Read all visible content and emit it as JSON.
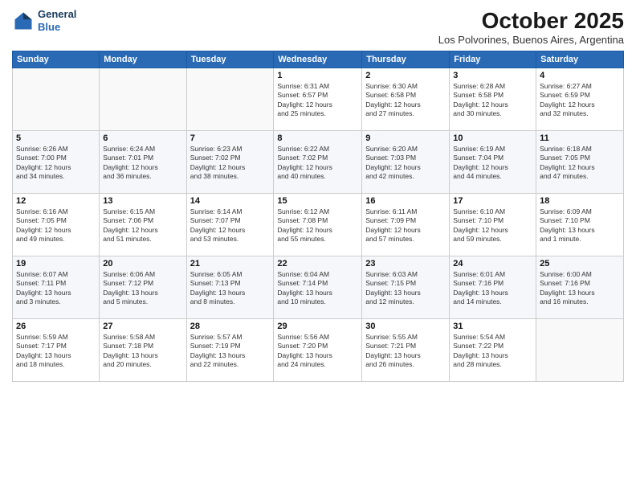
{
  "header": {
    "logo_line1": "General",
    "logo_line2": "Blue",
    "month": "October 2025",
    "location": "Los Polvorines, Buenos Aires, Argentina"
  },
  "weekdays": [
    "Sunday",
    "Monday",
    "Tuesday",
    "Wednesday",
    "Thursday",
    "Friday",
    "Saturday"
  ],
  "rows": [
    [
      {
        "day": "",
        "text": ""
      },
      {
        "day": "",
        "text": ""
      },
      {
        "day": "",
        "text": ""
      },
      {
        "day": "1",
        "text": "Sunrise: 6:31 AM\nSunset: 6:57 PM\nDaylight: 12 hours\nand 25 minutes."
      },
      {
        "day": "2",
        "text": "Sunrise: 6:30 AM\nSunset: 6:58 PM\nDaylight: 12 hours\nand 27 minutes."
      },
      {
        "day": "3",
        "text": "Sunrise: 6:28 AM\nSunset: 6:58 PM\nDaylight: 12 hours\nand 30 minutes."
      },
      {
        "day": "4",
        "text": "Sunrise: 6:27 AM\nSunset: 6:59 PM\nDaylight: 12 hours\nand 32 minutes."
      }
    ],
    [
      {
        "day": "5",
        "text": "Sunrise: 6:26 AM\nSunset: 7:00 PM\nDaylight: 12 hours\nand 34 minutes."
      },
      {
        "day": "6",
        "text": "Sunrise: 6:24 AM\nSunset: 7:01 PM\nDaylight: 12 hours\nand 36 minutes."
      },
      {
        "day": "7",
        "text": "Sunrise: 6:23 AM\nSunset: 7:02 PM\nDaylight: 12 hours\nand 38 minutes."
      },
      {
        "day": "8",
        "text": "Sunrise: 6:22 AM\nSunset: 7:02 PM\nDaylight: 12 hours\nand 40 minutes."
      },
      {
        "day": "9",
        "text": "Sunrise: 6:20 AM\nSunset: 7:03 PM\nDaylight: 12 hours\nand 42 minutes."
      },
      {
        "day": "10",
        "text": "Sunrise: 6:19 AM\nSunset: 7:04 PM\nDaylight: 12 hours\nand 44 minutes."
      },
      {
        "day": "11",
        "text": "Sunrise: 6:18 AM\nSunset: 7:05 PM\nDaylight: 12 hours\nand 47 minutes."
      }
    ],
    [
      {
        "day": "12",
        "text": "Sunrise: 6:16 AM\nSunset: 7:05 PM\nDaylight: 12 hours\nand 49 minutes."
      },
      {
        "day": "13",
        "text": "Sunrise: 6:15 AM\nSunset: 7:06 PM\nDaylight: 12 hours\nand 51 minutes."
      },
      {
        "day": "14",
        "text": "Sunrise: 6:14 AM\nSunset: 7:07 PM\nDaylight: 12 hours\nand 53 minutes."
      },
      {
        "day": "15",
        "text": "Sunrise: 6:12 AM\nSunset: 7:08 PM\nDaylight: 12 hours\nand 55 minutes."
      },
      {
        "day": "16",
        "text": "Sunrise: 6:11 AM\nSunset: 7:09 PM\nDaylight: 12 hours\nand 57 minutes."
      },
      {
        "day": "17",
        "text": "Sunrise: 6:10 AM\nSunset: 7:10 PM\nDaylight: 12 hours\nand 59 minutes."
      },
      {
        "day": "18",
        "text": "Sunrise: 6:09 AM\nSunset: 7:10 PM\nDaylight: 13 hours\nand 1 minute."
      }
    ],
    [
      {
        "day": "19",
        "text": "Sunrise: 6:07 AM\nSunset: 7:11 PM\nDaylight: 13 hours\nand 3 minutes."
      },
      {
        "day": "20",
        "text": "Sunrise: 6:06 AM\nSunset: 7:12 PM\nDaylight: 13 hours\nand 5 minutes."
      },
      {
        "day": "21",
        "text": "Sunrise: 6:05 AM\nSunset: 7:13 PM\nDaylight: 13 hours\nand 8 minutes."
      },
      {
        "day": "22",
        "text": "Sunrise: 6:04 AM\nSunset: 7:14 PM\nDaylight: 13 hours\nand 10 minutes."
      },
      {
        "day": "23",
        "text": "Sunrise: 6:03 AM\nSunset: 7:15 PM\nDaylight: 13 hours\nand 12 minutes."
      },
      {
        "day": "24",
        "text": "Sunrise: 6:01 AM\nSunset: 7:16 PM\nDaylight: 13 hours\nand 14 minutes."
      },
      {
        "day": "25",
        "text": "Sunrise: 6:00 AM\nSunset: 7:16 PM\nDaylight: 13 hours\nand 16 minutes."
      }
    ],
    [
      {
        "day": "26",
        "text": "Sunrise: 5:59 AM\nSunset: 7:17 PM\nDaylight: 13 hours\nand 18 minutes."
      },
      {
        "day": "27",
        "text": "Sunrise: 5:58 AM\nSunset: 7:18 PM\nDaylight: 13 hours\nand 20 minutes."
      },
      {
        "day": "28",
        "text": "Sunrise: 5:57 AM\nSunset: 7:19 PM\nDaylight: 13 hours\nand 22 minutes."
      },
      {
        "day": "29",
        "text": "Sunrise: 5:56 AM\nSunset: 7:20 PM\nDaylight: 13 hours\nand 24 minutes."
      },
      {
        "day": "30",
        "text": "Sunrise: 5:55 AM\nSunset: 7:21 PM\nDaylight: 13 hours\nand 26 minutes."
      },
      {
        "day": "31",
        "text": "Sunrise: 5:54 AM\nSunset: 7:22 PM\nDaylight: 13 hours\nand 28 minutes."
      },
      {
        "day": "",
        "text": ""
      }
    ]
  ]
}
